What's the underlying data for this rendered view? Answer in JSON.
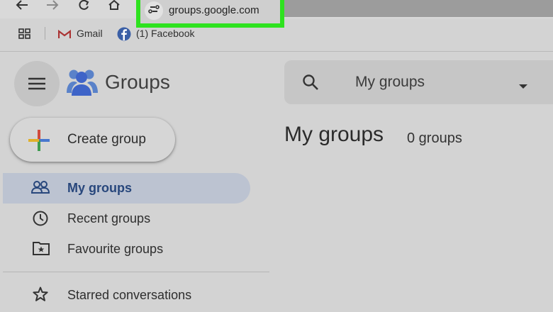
{
  "browser": {
    "url": "groups.google.com",
    "bookmarks": [
      {
        "label": "Gmail",
        "icon": "gmail-icon"
      },
      {
        "label": "(1) Facebook",
        "icon": "facebook-icon"
      }
    ]
  },
  "header": {
    "app_name": "Groups",
    "search": {
      "scope": "My groups"
    }
  },
  "sidebar": {
    "create_label": "Create group",
    "items": [
      {
        "label": "My groups",
        "icon": "people-icon",
        "active": true
      },
      {
        "label": "Recent groups",
        "icon": "clock-icon",
        "active": false
      },
      {
        "label": "Favourite groups",
        "icon": "folder-star-icon",
        "active": false
      },
      {
        "label": "Starred conversations",
        "icon": "star-icon",
        "active": false
      }
    ]
  },
  "main": {
    "title": "My groups",
    "count": "0 groups"
  },
  "colors": {
    "highlight_border": "#2ee21f",
    "active_item_bg": "#bcc3d1",
    "active_item_text": "#28477c",
    "logo_blue": "#3e64c8"
  }
}
